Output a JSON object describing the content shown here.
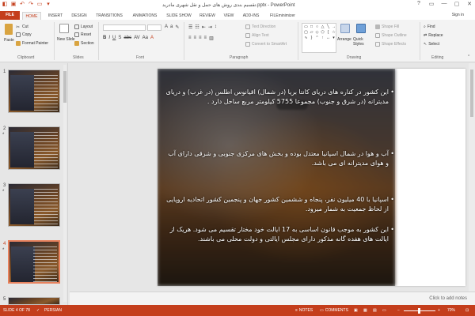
{
  "app": {
    "title": "تقسیم بندی روش های حمل و نقل شهری مادرید.pptx - PowerPoint",
    "sign_in": "Sign in"
  },
  "window": {
    "help": "?",
    "minimize": "—",
    "maximize": "▢",
    "close": "✕"
  },
  "tabs": [
    {
      "label": "FILE"
    },
    {
      "label": "HOME"
    },
    {
      "label": "INSERT"
    },
    {
      "label": "DESIGN"
    },
    {
      "label": "TRANSITIONS"
    },
    {
      "label": "ANIMATIONS"
    },
    {
      "label": "SLIDE SHOW"
    },
    {
      "label": "REVIEW"
    },
    {
      "label": "VIEW"
    },
    {
      "label": "ADD-INS"
    },
    {
      "label": "FILEminimizer"
    }
  ],
  "ribbon": {
    "clipboard": {
      "paste": "Paste",
      "cut": "Cut",
      "copy": "Copy",
      "format_painter": "Format Painter",
      "label": "Clipboard"
    },
    "slides": {
      "new_slide": "New Slide",
      "layout": "Layout",
      "reset": "Reset",
      "section": "Section",
      "label": "Slides"
    },
    "font": {
      "label": "Font"
    },
    "paragraph": {
      "text_direction": "Text Direction",
      "align_text": "Align Text",
      "smartart": "Convert to SmartArt",
      "label": "Paragraph"
    },
    "drawing": {
      "arrange": "Arrange",
      "quick_styles": "Quick Styles",
      "shape_fill": "Shape Fill",
      "shape_outline": "Shape Outline",
      "shape_effects": "Shape Effects",
      "label": "Drawing"
    },
    "editing": {
      "find": "Find",
      "replace": "Replace",
      "select": "Select",
      "label": "Editing"
    }
  },
  "thumbnails": [
    {
      "num": "1",
      "star": ""
    },
    {
      "num": "2",
      "star": "*"
    },
    {
      "num": "3",
      "star": "*"
    },
    {
      "num": "4",
      "star": "*"
    },
    {
      "num": "5",
      "star": ""
    }
  ],
  "slide": {
    "bullets": [
      "این کشور در کناره های دریای کانتا بریا (در شمال) اقیانوس اطلس (در غرب) و دریای مدیترانه (در شرق و جنوب) مجموعا 5755 کیلومتر مربع ساحل دارد .",
      "آب و هوا در شمال اسپانیا معتدل بوده و بخش های مرکزی جنوبی و شرقی دارای آب و هوای مدیترانه ای می باشد.",
      "اسپانیا با 40 میلیون نفر، پنجاه و ششمین کشور جهان و پنجمین کشور اتحادیه اروپایی از لحاظ جمعیت به شمار میرود.",
      "این کشور به موجب قانون اساسی به 17 ایالت خود مختار تقسیم می شود. هریک از ایالت های هفده گانه مذکور دارای مجلس ایالتی و دولت محلی می باشند."
    ]
  },
  "notes": {
    "placeholder": "Click to add notes"
  },
  "status": {
    "slide": "SLIDE 4 OF 78",
    "language": "PERSIAN",
    "notes": "NOTES",
    "comments": "COMMENTS",
    "zoom": "70%"
  },
  "colors": {
    "accent": "#c43e1c"
  }
}
